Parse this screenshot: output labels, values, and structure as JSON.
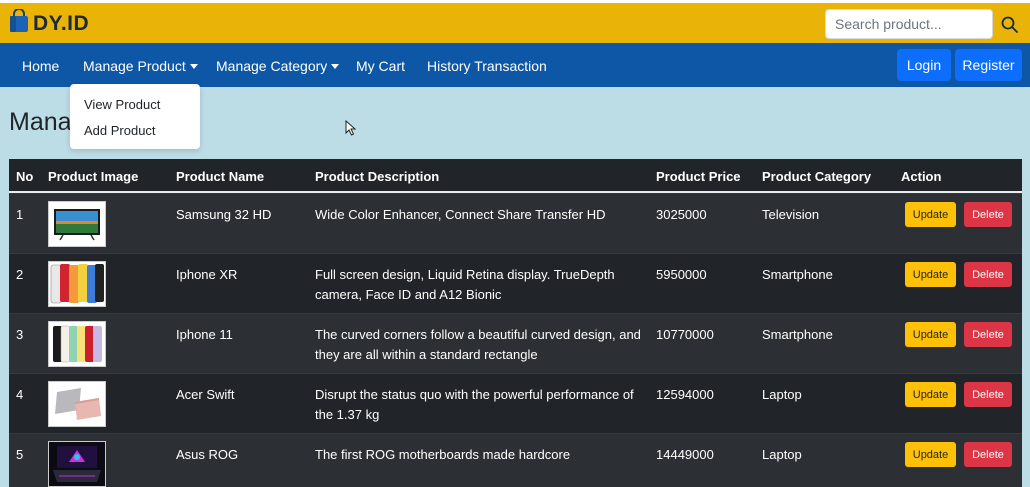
{
  "header": {
    "brand": "DY.ID",
    "search_placeholder": "Search product...",
    "accent_color": "#eab308",
    "icons": [
      "shopping-bag-icon",
      "search-icon"
    ]
  },
  "nav": {
    "items": [
      "Home",
      "Manage Product",
      "Manage Category",
      "My Cart",
      "History Transaction"
    ],
    "login": "Login",
    "register": "Register",
    "color": "#0d57a6"
  },
  "dropdown": {
    "items": [
      "View Product",
      "Add Product"
    ]
  },
  "page": {
    "title": "Manag"
  },
  "table": {
    "headers": [
      "No",
      "Product Image",
      "Product Name",
      "Product Description",
      "Product Price",
      "Product Category",
      "Action"
    ],
    "update_label": "Update",
    "delete_label": "Delete",
    "rows": [
      {
        "no": "1",
        "name": "Samsung 32 HD",
        "description": "Wide Color Enhancer, Connect Share Transfer HD",
        "price": "3025000",
        "category": "Television",
        "image_icon": "television-icon"
      },
      {
        "no": "2",
        "name": "Iphone XR",
        "description": "Full screen design, Liquid Retina display. TrueDepth camera, Face ID and A12 Bionic",
        "price": "5950000",
        "category": "Smartphone",
        "image_icon": "smartphones-icon"
      },
      {
        "no": "3",
        "name": "Iphone 11",
        "description": "The curved corners follow a beautiful curved design, and they are all within a standard rectangle",
        "price": "10770000",
        "category": "Smartphone",
        "image_icon": "smartphones-icon"
      },
      {
        "no": "4",
        "name": "Acer Swift",
        "description": "Disrupt the status quo with the powerful performance of the 1.37 kg",
        "price": "12594000",
        "category": "Laptop",
        "image_icon": "laptop-icon"
      },
      {
        "no": "5",
        "name": "Asus ROG",
        "description": "The first ROG motherboards made hardcore",
        "price": "14449000",
        "category": "Laptop",
        "image_icon": "gaming-laptop-icon"
      }
    ]
  }
}
